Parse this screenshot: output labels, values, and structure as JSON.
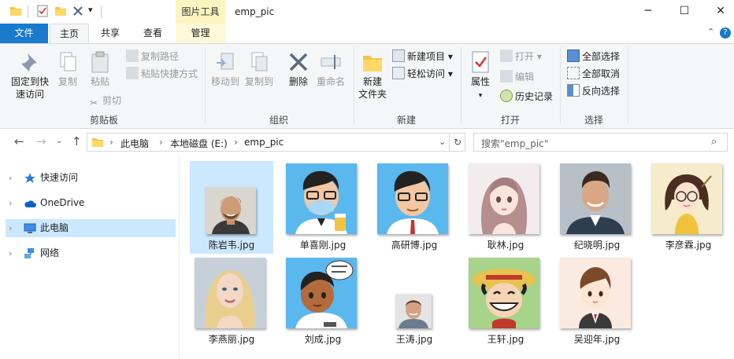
{
  "window": {
    "title": "emp_pic",
    "context_tab_group": "图片工具",
    "controls": [
      "─",
      "☐",
      "✕"
    ]
  },
  "tabs": {
    "file": "文件",
    "home": "主页",
    "share": "共享",
    "view": "查看",
    "manage": "管理"
  },
  "ribbon": {
    "clipboard": {
      "label": "剪贴板",
      "pin": "固定到快\n速访问",
      "pin_l1": "固定到快",
      "pin_l2": "速访问",
      "copy": "复制",
      "paste": "粘贴",
      "copy_path": "复制路径",
      "paste_shortcut": "粘贴快捷方式",
      "cut": "剪切"
    },
    "organize": {
      "label": "组织",
      "move_to": "移动到",
      "copy_to": "复制到",
      "delete": "删除",
      "rename": "重命名"
    },
    "new": {
      "label": "新建",
      "new_folder_l1": "新建",
      "new_folder_l2": "文件夹",
      "new_item": "新建项目",
      "easy_access": "轻松访问"
    },
    "open": {
      "label": "打开",
      "properties": "属性",
      "open": "打开",
      "edit": "编辑",
      "history": "历史记录"
    },
    "select": {
      "label": "选择",
      "select_all": "全部选择",
      "select_none": "全部取消",
      "invert": "反向选择"
    }
  },
  "address": {
    "crumbs": [
      "此电脑",
      "本地磁盘 (E:)",
      "emp_pic"
    ],
    "search_placeholder": "搜索\"emp_pic\""
  },
  "nav": {
    "items": [
      {
        "label": "快速访问",
        "icon": "star-icon"
      },
      {
        "label": "OneDrive",
        "icon": "cloud-icon"
      },
      {
        "label": "此电脑",
        "icon": "computer-icon"
      },
      {
        "label": "网络",
        "icon": "network-icon"
      }
    ]
  },
  "files": [
    {
      "name": "陈岩韦.jpg",
      "image": "photo-man-beard"
    },
    {
      "name": "单喜刚.jpg",
      "image": "cartoon-man-mask"
    },
    {
      "name": "高研博.jpg",
      "image": "cartoon-man-glasses"
    },
    {
      "name": "耿林.jpg",
      "image": "anime-girl-long-hair"
    },
    {
      "name": "纪晓明.jpg",
      "image": "photo-man-smiling"
    },
    {
      "name": "李彦霖.jpg",
      "image": "cartoon-girl-glasses"
    },
    {
      "name": "李燕丽.jpg",
      "image": "photo-blonde-woman"
    },
    {
      "name": "刘成.jpg",
      "image": "cartoon-boy-speech"
    },
    {
      "name": "王涛.jpg",
      "image": "photo-man-small"
    },
    {
      "name": "王轩.jpg",
      "image": "cartoon-straw-hat"
    },
    {
      "name": "吴迎年.jpg",
      "image": "cartoon-boy-suit"
    }
  ],
  "colors": {
    "file_tab": "#1979ca",
    "selection": "#cce8ff",
    "context_tab": "#fbf5c0"
  }
}
